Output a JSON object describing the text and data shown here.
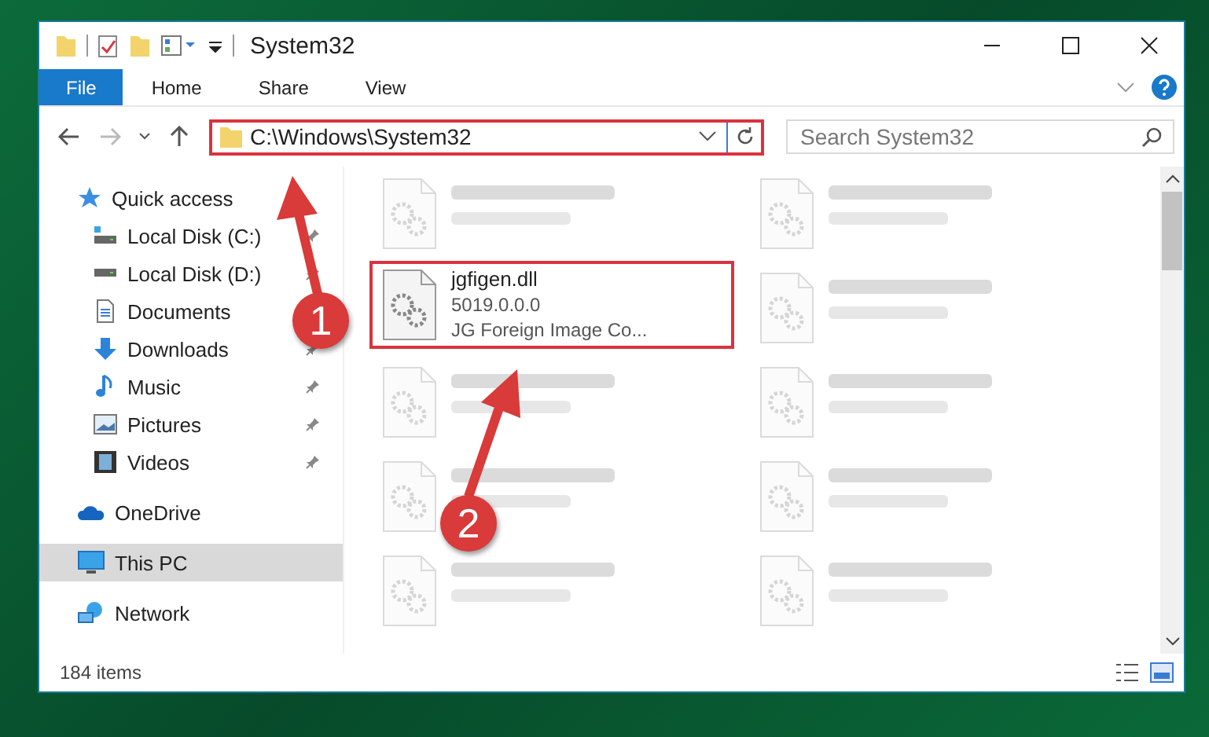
{
  "window": {
    "title": "System32"
  },
  "ribbon_tabs": [
    {
      "label": "File",
      "kind": "file"
    },
    {
      "label": "Home",
      "kind": "tab"
    },
    {
      "label": "Share",
      "kind": "tab"
    },
    {
      "label": "View",
      "kind": "tab"
    }
  ],
  "address": {
    "path": "C:\\Windows\\System32"
  },
  "search": {
    "placeholder": "Search System32"
  },
  "sidebar": {
    "items": [
      {
        "label": "Quick access",
        "kind": "group",
        "selected": false
      },
      {
        "label": "Local Disk (C:)",
        "kind": "item",
        "pinned": true,
        "selected": false
      },
      {
        "label": "Local Disk (D:)",
        "kind": "item",
        "pinned": true,
        "selected": false
      },
      {
        "label": "Documents",
        "kind": "item",
        "pinned": false,
        "selected": false
      },
      {
        "label": "Downloads",
        "kind": "item",
        "pinned": true,
        "selected": false
      },
      {
        "label": "Music",
        "kind": "item",
        "pinned": true,
        "selected": false
      },
      {
        "label": "Pictures",
        "kind": "item",
        "pinned": true,
        "selected": false
      },
      {
        "label": "Videos",
        "kind": "item",
        "pinned": true,
        "selected": false
      },
      {
        "label": "OneDrive",
        "kind": "group",
        "selected": false
      },
      {
        "label": "This PC",
        "kind": "group",
        "selected": true
      },
      {
        "label": "Network",
        "kind": "group",
        "selected": false
      }
    ]
  },
  "files": [
    {
      "kind": "blurred"
    },
    {
      "kind": "blurred"
    },
    {
      "kind": "clear",
      "lines": [
        "jgfigen.dll",
        "5019.0.0.0",
        "JG Foreign Image Co..."
      ]
    },
    {
      "kind": "blurred"
    },
    {
      "kind": "blurred"
    },
    {
      "kind": "blurred"
    },
    {
      "kind": "blurred"
    },
    {
      "kind": "blurred"
    },
    {
      "kind": "blurred"
    },
    {
      "kind": "blurred"
    }
  ],
  "status_bar": {
    "count": "184 items"
  },
  "annotations": [
    {
      "number": "1"
    },
    {
      "number": "2"
    }
  ]
}
